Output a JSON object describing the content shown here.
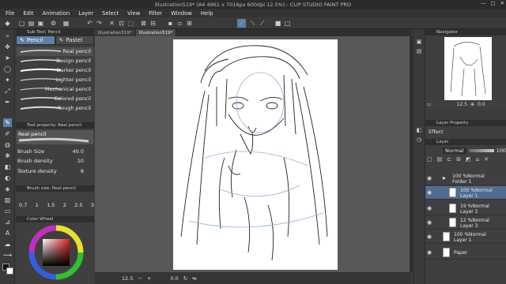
{
  "window": {
    "title": "Illustration519* (A4 4961 x 7016px 600dpi 12.5%) - CLIP STUDIO PAINT PRO",
    "minimize": "—",
    "maximize": "□",
    "close": "✕"
  },
  "menu": [
    "File",
    "Edit",
    "Animation",
    "Layer",
    "Select",
    "View",
    "Filter",
    "Window",
    "Help"
  ],
  "doc_tabs": [
    {
      "label": "Illustration519*",
      "active": false
    },
    {
      "label": "Illustration519*",
      "active": true
    }
  ],
  "sub_tool": {
    "header": "Sub Tool: Pencil",
    "tabs": [
      "Pencil",
      "Pastel"
    ],
    "brushes": [
      "Real pencil",
      "Design pencil",
      "Darker pencil",
      "Lighter pencil",
      "Mechanical pencil",
      "Colored pencil",
      "Rough pencil"
    ],
    "selected_index": 0
  },
  "tool_property": {
    "header": "Tool property: Real pencil",
    "preset": "Real pencil",
    "rows": [
      {
        "label": "Brush Size",
        "value": "40.0"
      },
      {
        "label": "Brush density",
        "value": "10"
      },
      {
        "label": "Texture density",
        "value": "8"
      }
    ]
  },
  "brush_size": {
    "header": "Brush size: Real pencil",
    "sizes": [
      "0.7",
      "1",
      "1.5",
      "2",
      "2.5",
      "3"
    ]
  },
  "color_wheel": {
    "header": "Color Wheel",
    "main_color": "#1a1a1a",
    "sub_color": "#ffffff",
    "accent": "#5f7fa6"
  },
  "status": {
    "zoom": "12.5",
    "rotation": "0.0"
  },
  "navigator": {
    "header": "Navigator",
    "zoom": "12.5",
    "rotation": "0.0"
  },
  "layer_property": {
    "header": "Layer Property",
    "effect_label": "Effect"
  },
  "layers": {
    "header": "Layer",
    "blend_mode": "Normal",
    "opacity": "100",
    "items": [
      {
        "line1": "100 %Normal",
        "line2": "Folder 1",
        "selected": false
      },
      {
        "line1": "100 %Normal",
        "line2": "Layer 1",
        "selected": true
      },
      {
        "line1": "19 %Normal",
        "line2": "Layer 2",
        "selected": false
      },
      {
        "line1": "12 %Normal",
        "line2": "Layer 3",
        "selected": false
      },
      {
        "line1": "100 %Normal",
        "line2": "Layer 1",
        "selected": false
      },
      {
        "line1": "",
        "line2": "Paper",
        "selected": false
      }
    ]
  },
  "icons": [
    "pen-icon",
    "pencil-icon",
    "brush-icon",
    "eraser-icon",
    "fill-icon",
    "gradient-icon",
    "text-icon",
    "select-icon",
    "eye-icon",
    "folder-icon",
    "gear-icon",
    "hand-icon",
    "zoom-icon",
    "undo-icon",
    "redo-icon"
  ]
}
